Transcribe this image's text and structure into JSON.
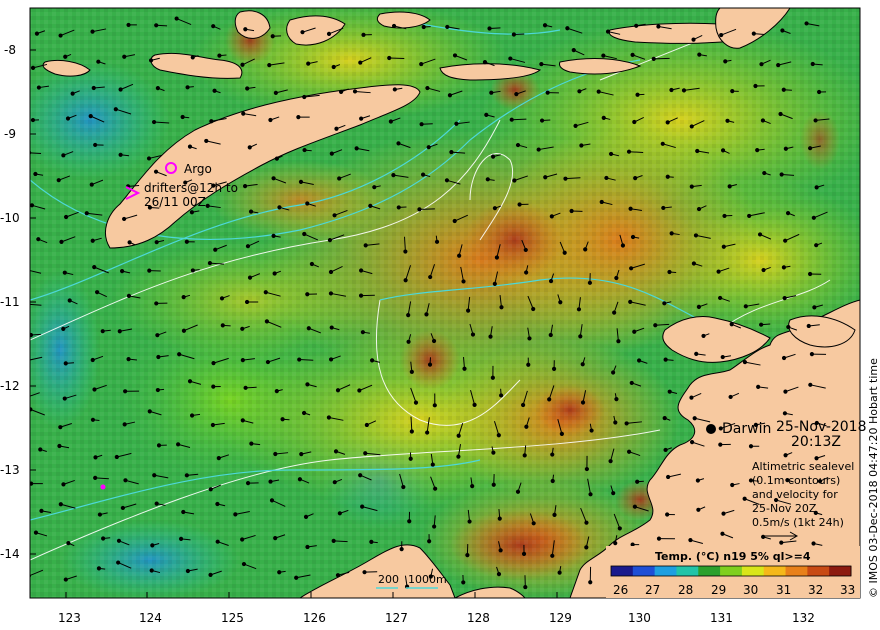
{
  "axes": {
    "lon_ticks": [
      "123",
      "124",
      "125",
      "126",
      "127",
      "128",
      "129",
      "130",
      "131",
      "132"
    ],
    "lat_ticks": [
      "-8",
      "-9",
      "-10",
      "-11",
      "-12",
      "-13",
      "-14"
    ],
    "lon_range": [
      122.6,
      132.6
    ],
    "lat_range": [
      -7.6,
      -14.5
    ]
  },
  "legend": {
    "argo_label": "Argo",
    "drifters_line1": "drifters@12h to",
    "drifters_line2": "26/11 00Z",
    "argo_color": "#ff00ff",
    "drifter_color": "#ff00ff"
  },
  "place": {
    "city": "Darwin",
    "date": "25-Nov-2018",
    "time": "20:13Z"
  },
  "altimetry_note": {
    "line1": "Altimetric sealevel",
    "line2": "(0.1m contours)",
    "line3": "and velocity for",
    "line4": "25-Nov 20Z",
    "line5": "0.5m/s (1kt 24h)"
  },
  "isobath": {
    "label1": "200",
    "label2": "1000m",
    "color": "#4dd8d8"
  },
  "colorbar": {
    "title": "Temp. (°C) n19 5% ql>=4",
    "ticks": [
      "26",
      "27",
      "28",
      "29",
      "30",
      "31",
      "32",
      "33"
    ],
    "colors": [
      "#1a1a8c",
      "#1f4fd6",
      "#1f9fe0",
      "#22c4a8",
      "#2ca02c",
      "#7fcf1f",
      "#d9e61a",
      "#f5b81a",
      "#e8801a",
      "#c84a14",
      "#8c1a10"
    ]
  },
  "credit": "© IMOS 03-Dec-2018 04:47:20 Hobart time",
  "colors": {
    "land": "#f7c9a0",
    "sst_base": "#3cb44b",
    "warm": "#e8a21a",
    "hot": "#c8501a",
    "cool": "#1fa0c8"
  }
}
